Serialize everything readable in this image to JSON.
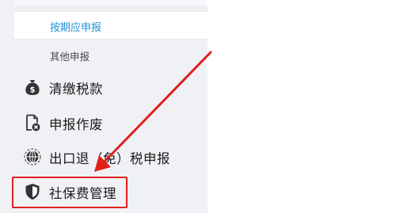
{
  "sidebar": {
    "sub_items": {
      "active": {
        "label": "按期应申报"
      },
      "other": {
        "label": "其他申报"
      }
    },
    "items": {
      "tax": {
        "label": "清缴税款",
        "icon": "money-bag-icon"
      },
      "report": {
        "label": "申报作废",
        "icon": "void-document-icon"
      },
      "export": {
        "label": "出口退（免）税申报",
        "icon": "globe-icon"
      },
      "social": {
        "label": "社保费管理",
        "icon": "shield-icon"
      }
    }
  },
  "annotation": {
    "color": "#e0201c"
  },
  "colors": {
    "sidebar_bg": "#eff1f4",
    "active_text": "#1f8fd6"
  }
}
